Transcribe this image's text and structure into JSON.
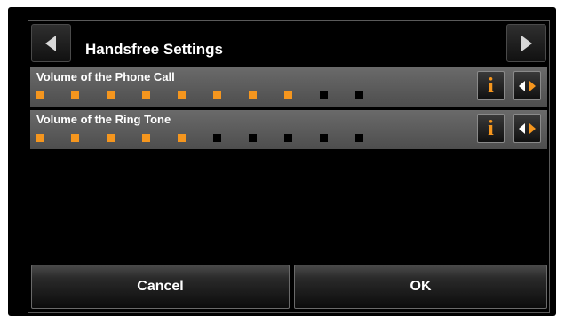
{
  "header": {
    "title": "Handsfree Settings",
    "prev_icon": "triangle-left",
    "next_icon": "triangle-right"
  },
  "settings": [
    {
      "label": "Volume of the Phone Call",
      "level": 8,
      "max": 10
    },
    {
      "label": "Volume of the Ring Tone",
      "level": 5,
      "max": 10
    }
  ],
  "row_buttons": {
    "info_glyph": "i",
    "adjust_icon": "left-right-arrows"
  },
  "footer": {
    "cancel_label": "Cancel",
    "ok_label": "OK"
  },
  "colors": {
    "accent": "#f5961e",
    "inactive": "#000000",
    "row_bg": "#5c5c5c"
  }
}
